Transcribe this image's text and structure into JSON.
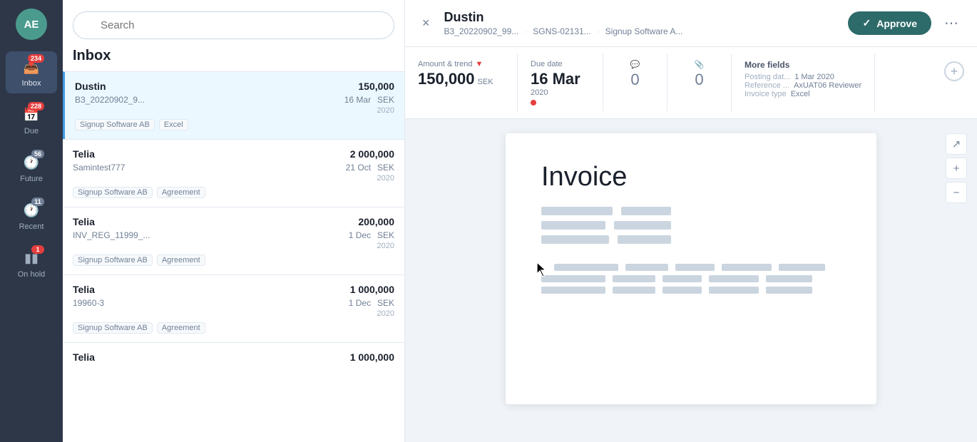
{
  "sidebar": {
    "avatar": {
      "initials": "AE",
      "color": "#4a9b8e"
    },
    "nav": [
      {
        "id": "inbox",
        "label": "Inbox",
        "icon": "inbox",
        "badge": "234",
        "badge_type": "blue",
        "active": true
      },
      {
        "id": "due",
        "label": "Due",
        "icon": "calendar",
        "badge": "228",
        "badge_type": "red"
      },
      {
        "id": "future",
        "label": "Future",
        "icon": "clock",
        "badge": "56",
        "badge_type": "gray"
      },
      {
        "id": "recent",
        "label": "Recent",
        "icon": "recent",
        "badge": "11",
        "badge_type": "gray"
      },
      {
        "id": "on-hold",
        "label": "On hold",
        "icon": "pause",
        "badge": "1",
        "badge_type": "red"
      }
    ]
  },
  "left_panel": {
    "search_placeholder": "Search",
    "inbox_title": "Inbox",
    "invoices": [
      {
        "id": 1,
        "name": "Dustin",
        "ref": "B3_20220902_9...",
        "date": "16 Mar",
        "year": "2020",
        "amount": "150,000",
        "currency": "SEK",
        "tags": [
          "Signup Software AB",
          "Excel"
        ],
        "active": true
      },
      {
        "id": 2,
        "name": "Telia",
        "ref": "Samintest777",
        "date": "21 Oct",
        "year": "2020",
        "amount": "2 000,000",
        "currency": "SEK",
        "tags": [
          "Signup Software AB",
          "Agreement"
        ],
        "active": false
      },
      {
        "id": 3,
        "name": "Telia",
        "ref": "INV_REG_11999_...",
        "date": "1 Dec",
        "year": "2020",
        "amount": "200,000",
        "currency": "SEK",
        "tags": [
          "Signup Software AB",
          "Agreement"
        ],
        "active": false
      },
      {
        "id": 4,
        "name": "Telia",
        "ref": "19960-3",
        "date": "1 Dec",
        "year": "2020",
        "amount": "1 000,000",
        "currency": "SEK",
        "tags": [
          "Signup Software AB",
          "Agreement"
        ],
        "active": false
      },
      {
        "id": 5,
        "name": "Telia",
        "ref": "",
        "date": "",
        "year": "",
        "amount": "1 000,000",
        "currency": "",
        "tags": [],
        "active": false
      }
    ]
  },
  "detail": {
    "title": "Dustin",
    "breadcrumbs": [
      "B3_20220902_99...",
      "SGNS-02131...",
      "Signup Software A..."
    ],
    "approve_label": "Approve",
    "close_label": "×",
    "more_label": "⋯",
    "info": {
      "amount_label": "Amount & trend",
      "amount_value": "150,000",
      "amount_currency": "SEK",
      "due_date_label": "Due date",
      "due_date_value": "16 Mar",
      "due_date_year": "2020",
      "comments_label": "💬",
      "comments_value": "0",
      "attachments_label": "📎",
      "attachments_value": "0",
      "more_fields_label": "More fields",
      "posting_date_key": "Posting dat...",
      "posting_date_val": "1 Mar 2020",
      "reference_key": "Reference ...",
      "reference_val": "AxUAT06 Reviewer",
      "invoice_type_key": "Invoice type",
      "invoice_type_val": "Excel"
    },
    "invoice_doc": {
      "heading": "Invoice"
    },
    "zoom": {
      "expand_label": "⤢",
      "zoom_in_label": "+",
      "zoom_out_label": "−"
    }
  }
}
